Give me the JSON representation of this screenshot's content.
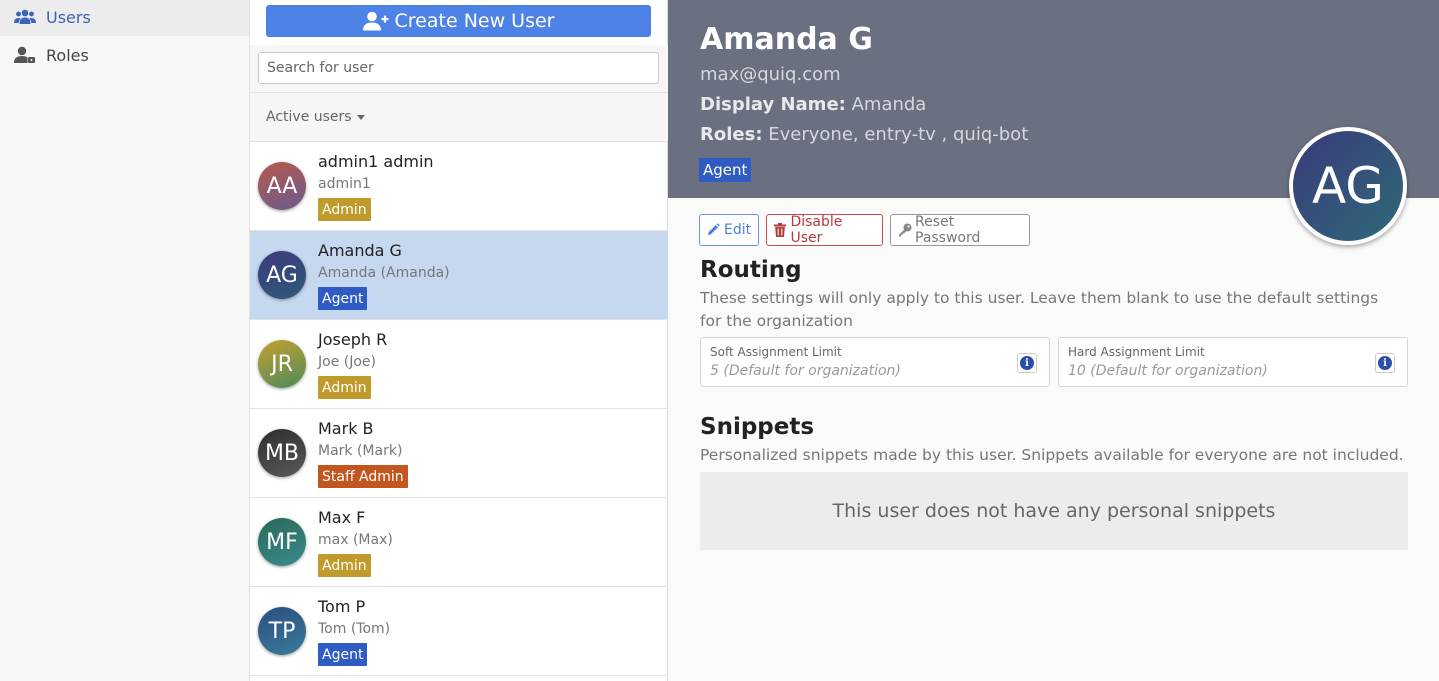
{
  "nav": {
    "items": [
      {
        "label": "Users",
        "icon": "users-icon"
      },
      {
        "label": "Roles",
        "icon": "user-roles-icon"
      }
    ]
  },
  "list": {
    "create_label": "Create New User",
    "search_placeholder": "Search for user",
    "filter_label": "Active users",
    "users": [
      {
        "initials": "AA",
        "name": "admin1 admin",
        "sub": "admin1",
        "badge": "Admin"
      },
      {
        "initials": "AG",
        "name": "Amanda G",
        "sub": "Amanda (Amanda)",
        "badge": "Agent"
      },
      {
        "initials": "JR",
        "name": "Joseph R",
        "sub": "Joe (Joe)",
        "badge": "Admin"
      },
      {
        "initials": "MB",
        "name": "Mark B",
        "sub": "Mark (Mark)",
        "badge": "Staff Admin"
      },
      {
        "initials": "MF",
        "name": "Max F",
        "sub": "max (Max)",
        "badge": "Admin"
      },
      {
        "initials": "TP",
        "name": "Tom P",
        "sub": "Tom (Tom)",
        "badge": "Agent"
      }
    ]
  },
  "detail": {
    "name": "Amanda G",
    "email": "max@quiq.com",
    "display_name_label": "Display Name:",
    "display_name": "Amanda",
    "roles_label": "Roles:",
    "roles": "Everyone, entry-tv , quiq-bot",
    "badge": "Agent",
    "initials": "AG",
    "actions": {
      "edit": "Edit",
      "disable": "Disable User",
      "reset": "Reset Password"
    },
    "routing": {
      "title": "Routing",
      "description": "These settings will only apply to this user. Leave them blank to use the default settings for the organization",
      "soft_label": "Soft Assignment Limit",
      "soft_placeholder": "5 (Default for organization)",
      "hard_label": "Hard Assignment Limit",
      "hard_placeholder": "10 (Default for organization)"
    },
    "snippets": {
      "title": "Snippets",
      "description": "Personalized snippets made by this user. Snippets available for everyone are not included.",
      "empty": "This user does not have any personal snippets"
    }
  },
  "colors": {
    "primary": "#4d82e6",
    "header_bg": "#6b7080",
    "badge_admin": "#c09a2a",
    "badge_agent": "#2f5bc4",
    "badge_staff_admin": "#c2561e",
    "selected_row": "#c6d8f0"
  }
}
